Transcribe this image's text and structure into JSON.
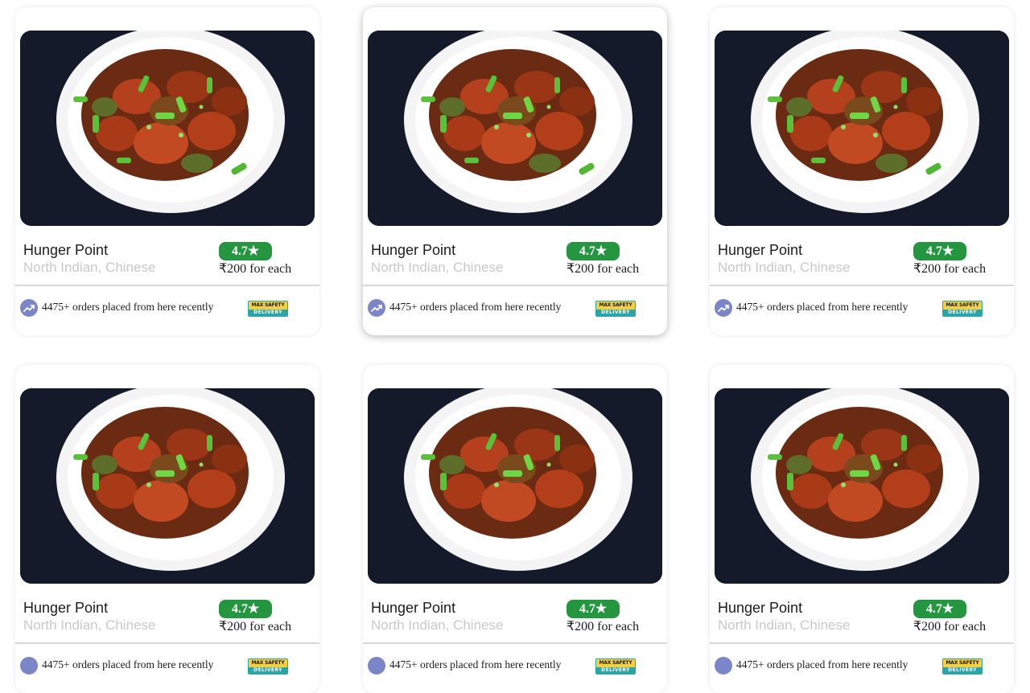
{
  "restaurants": [
    {
      "name": "Hunger Point",
      "cuisine": "North Indian, Chinese",
      "rating": "4.7★",
      "price": "₹200 for each",
      "orders": "4475+ orders placed from here recently",
      "badge_top": "MAX SAFETY",
      "badge_bottom": "DELIVERY",
      "image": "chilli-chicken-plate",
      "trend_icon": "trending-up-icon"
    },
    {
      "name": "Hunger Point",
      "cuisine": "North Indian, Chinese",
      "rating": "4.7★",
      "price": "₹200 for each",
      "orders": "4475+ orders placed from here recently",
      "badge_top": "MAX SAFETY",
      "badge_bottom": "DELIVERY",
      "image": "chilli-chicken-plate",
      "trend_icon": "trending-up-icon"
    },
    {
      "name": "Hunger Point",
      "cuisine": "North Indian, Chinese",
      "rating": "4.7★",
      "price": "₹200 for each",
      "orders": "4475+ orders placed from here recently",
      "badge_top": "MAX SAFETY",
      "badge_bottom": "DELIVERY",
      "image": "chilli-chicken-plate",
      "trend_icon": "trending-up-icon"
    },
    {
      "name": "Hunger Point",
      "cuisine": "North Indian, Chinese",
      "rating": "4.7★",
      "price": "₹200 for each",
      "orders": "4475+ orders placed from here recently",
      "badge_top": "MAX SAFETY",
      "badge_bottom": "DELIVERY",
      "image": "chilli-chicken-plate",
      "trend_icon": "trending-up-icon"
    },
    {
      "name": "Hunger Point",
      "cuisine": "North Indian, Chinese",
      "rating": "4.7★",
      "price": "₹200 for each",
      "orders": "4475+ orders placed from here recently",
      "badge_top": "MAX SAFETY",
      "badge_bottom": "DELIVERY",
      "image": "chilli-chicken-plate",
      "trend_icon": "trending-up-icon"
    },
    {
      "name": "Hunger Point",
      "cuisine": "North Indian, Chinese",
      "rating": "4.7★",
      "price": "₹200 for each",
      "orders": "4475+ orders placed from here recently",
      "badge_top": "MAX SAFETY",
      "badge_bottom": "DELIVERY",
      "image": "chilli-chicken-plate",
      "trend_icon": "trending-up-icon"
    }
  ],
  "colors": {
    "rating_badge": "#24963f",
    "muted_text": "#c9c9c9",
    "trend_icon_bg": "#7b86c8",
    "safety_yellow": "#f4d03f",
    "safety_teal": "#2aa6a8"
  }
}
